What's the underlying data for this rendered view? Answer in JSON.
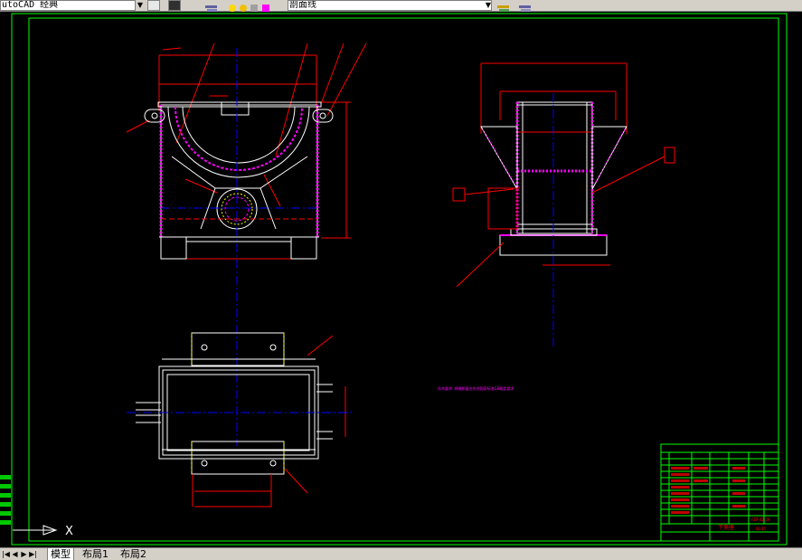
{
  "toolbar": {
    "workspace_value": "utoCAD 经典",
    "layer_value": "剖面线",
    "layer_color": "#ff00ff"
  },
  "layout_tabs": [
    {
      "label": "模型",
      "active": true
    },
    {
      "label": "布局1",
      "active": false
    },
    {
      "label": "布局2",
      "active": false
    }
  ],
  "ucs": {
    "x_label": "X"
  },
  "drawing": {
    "red_note": "技术要求: 焊缝质量应符合国家标准GB规定要求",
    "title_block": {
      "name": "下夹座",
      "code": "FZP-02-09",
      "material": "Q235"
    }
  },
  "colors": {
    "background": "#000000",
    "outline": "#ffffff",
    "dimension": "#ff0000",
    "center": "#0000ff",
    "hatch": "#ff00ff",
    "hidden": "#ffff00",
    "border": "#00ff00"
  }
}
